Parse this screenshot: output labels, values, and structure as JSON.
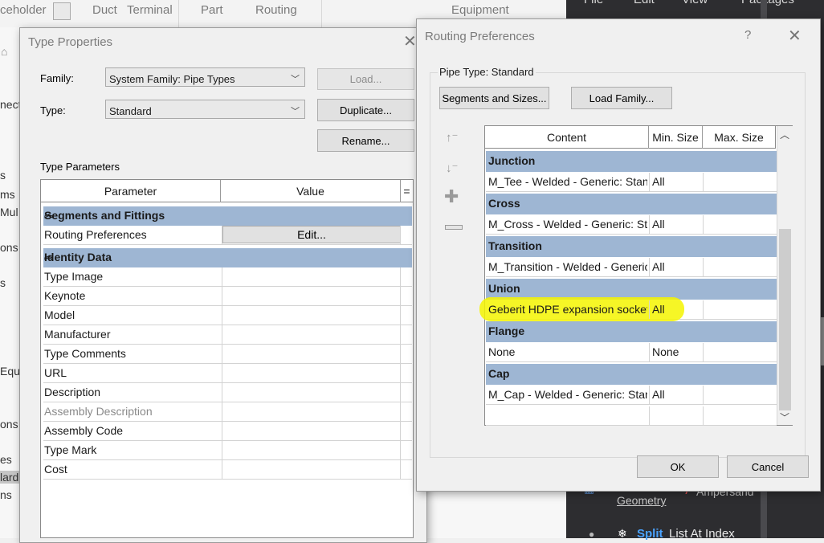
{
  "background_app": {
    "ribbon_tabs": [
      "ceholder",
      "Duct",
      "Terminal",
      "Part",
      "Routing",
      "Equipment"
    ],
    "left_strip": [
      "nect",
      "s",
      "ms",
      "Mul",
      "ons",
      "s",
      "Equi",
      "ons",
      "es",
      "lard",
      "ns"
    ],
    "dark_panel_menu": [
      "File",
      "Edit",
      "View",
      "Packages"
    ],
    "node_text_1": "Geometry",
    "node_text_2": "Ampersand",
    "node_text_3": "Split",
    "node_text_4": "List At Index"
  },
  "type_properties": {
    "title": "Type Properties",
    "family_label": "Family:",
    "family_value": "System Family: Pipe Types",
    "type_label": "Type:",
    "type_value": "Standard",
    "load_button": "Load...",
    "duplicate_button": "Duplicate...",
    "rename_button": "Rename...",
    "section_label": "Type Parameters",
    "col_parameter": "Parameter",
    "col_value": "Value",
    "col_equals": "=",
    "groups": [
      {
        "name": "Segments and Fittings",
        "rows": [
          {
            "name": "Routing Preferences",
            "edit": "Edit..."
          }
        ]
      },
      {
        "name": "Identity Data",
        "rows": [
          {
            "name": "Type Image"
          },
          {
            "name": "Keynote"
          },
          {
            "name": "Model"
          },
          {
            "name": "Manufacturer"
          },
          {
            "name": "Type Comments"
          },
          {
            "name": "URL"
          },
          {
            "name": "Description"
          },
          {
            "name": "Assembly Description",
            "muted": true
          },
          {
            "name": "Assembly Code"
          },
          {
            "name": "Type Mark"
          },
          {
            "name": "Cost"
          }
        ]
      }
    ]
  },
  "routing_preferences": {
    "title": "Routing Preferences",
    "help_icon": "?",
    "pipe_type_label": "Pipe Type: Standard",
    "segments_button": "Segments and Sizes...",
    "load_family_button": "Load Family...",
    "col_content": "Content",
    "col_min": "Min. Size",
    "col_max": "Max. Size",
    "groups": [
      {
        "name": "Junction",
        "content": "M_Tee - Welded - Generic: Standard",
        "min": "All",
        "max": ""
      },
      {
        "name": "Cross",
        "content": "M_Cross - Welded - Generic: Standard",
        "min": "All",
        "max": ""
      },
      {
        "name": "Transition",
        "content": "M_Transition - Welded - Generic: Standard",
        "min": "All",
        "max": ""
      },
      {
        "name": "Union",
        "content": "Geberit HDPE expansion socket",
        "min": "All",
        "max": "",
        "highlight": true
      },
      {
        "name": "Flange",
        "content": "None",
        "min": "None",
        "max": ""
      },
      {
        "name": "Cap",
        "content": "M_Cap - Welded - Generic: Standard",
        "min": "All",
        "max": ""
      }
    ],
    "ok_button": "OK",
    "cancel_button": "Cancel",
    "highlight_color": "#f5f500"
  }
}
